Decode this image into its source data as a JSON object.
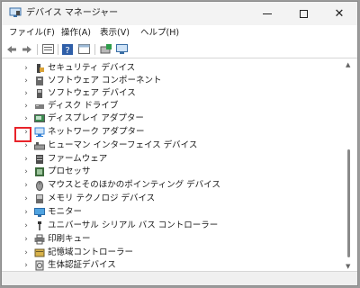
{
  "window": {
    "title": "デバイス マネージャー",
    "controls": {
      "minimize": "minimize",
      "maximize": "maximize",
      "close": "✕"
    }
  },
  "menu": [
    {
      "label": "ファイル(F)"
    },
    {
      "label": "操作(A)"
    },
    {
      "label": "表示(V)"
    },
    {
      "label": "ヘルプ(H)"
    }
  ],
  "toolbar": [
    {
      "icon": "back-arrow-icon"
    },
    {
      "icon": "forward-arrow-icon"
    },
    {
      "icon": "properties-sheet-icon"
    },
    {
      "icon": "help-icon"
    },
    {
      "icon": "show-hidden-icon"
    },
    {
      "icon": "update-driver-icon"
    },
    {
      "icon": "scan-hardware-monitor-icon"
    }
  ],
  "tree": {
    "items": [
      {
        "label": "セキュリティ デバイス",
        "icon": "security-device-icon"
      },
      {
        "label": "ソフトウェア コンポーネント",
        "icon": "software-component-icon"
      },
      {
        "label": "ソフトウェア デバイス",
        "icon": "software-device-icon"
      },
      {
        "label": "ディスク ドライブ",
        "icon": "disk-drive-icon"
      },
      {
        "label": "ディスプレイ アダプター",
        "icon": "display-adapter-icon"
      },
      {
        "label": "ネットワーク アダプター",
        "icon": "network-adapter-icon",
        "highlighted": true
      },
      {
        "label": "ヒューマン インターフェイス デバイス",
        "icon": "hid-icon"
      },
      {
        "label": "ファームウェア",
        "icon": "firmware-icon"
      },
      {
        "label": "プロセッサ",
        "icon": "processor-icon"
      },
      {
        "label": "マウスとそのほかのポインティング デバイス",
        "icon": "mouse-icon"
      },
      {
        "label": "メモリ テクノロジ デバイス",
        "icon": "memory-icon"
      },
      {
        "label": "モニター",
        "icon": "monitor-icon"
      },
      {
        "label": "ユニバーサル シリアル バス コントローラー",
        "icon": "usb-icon"
      },
      {
        "label": "印刷キュー",
        "icon": "printer-icon"
      },
      {
        "label": "記憶域コントローラー",
        "icon": "storage-controller-icon"
      },
      {
        "label": "生体認証デバイス",
        "icon": "biometric-icon"
      }
    ]
  },
  "colors": {
    "highlight_border": "#e8232a",
    "accent_blue": "#2f7fd6"
  }
}
